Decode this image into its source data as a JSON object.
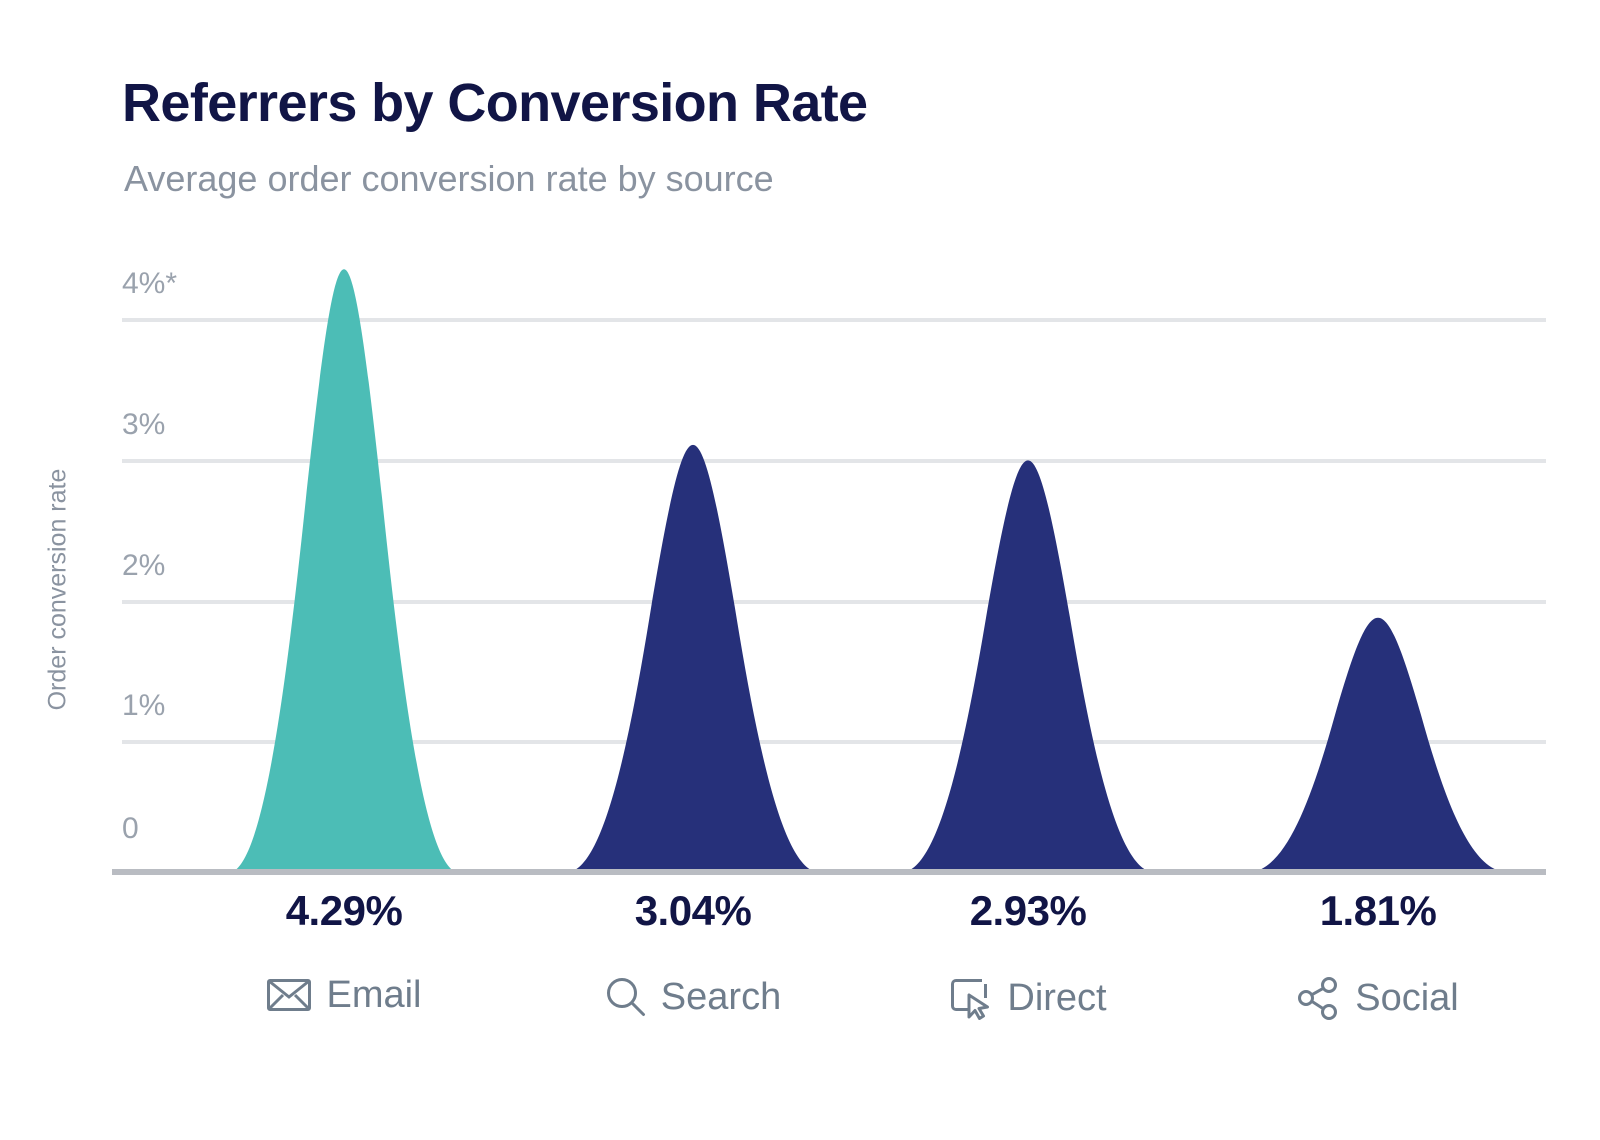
{
  "header": {
    "title": "Referrers by Conversion Rate",
    "subtitle": "Average order conversion rate by source"
  },
  "axis": {
    "y_title": "Order conversion rate",
    "y_ticks": [
      "4%*",
      "3%",
      "2%",
      "1%",
      "0"
    ]
  },
  "columns": [
    {
      "value_label": "4.29%",
      "name": "Email",
      "icon": "envelope-icon"
    },
    {
      "value_label": "3.04%",
      "name": "Search",
      "icon": "magnifier-icon"
    },
    {
      "value_label": "2.93%",
      "name": "Direct",
      "icon": "cursor-window-icon"
    },
    {
      "value_label": "1.81%",
      "name": "Social",
      "icon": "share-nodes-icon"
    }
  ],
  "colors": {
    "teal": "#4CBDB6",
    "navy": "#26307A",
    "title": "#111546",
    "muted": "#8a93a0",
    "label": "#6f7d8c",
    "gridline": "#e3e5e8",
    "baseline": "#b9bcc2"
  },
  "chart_data": {
    "type": "bar",
    "title": "Referrers by Conversion Rate",
    "subtitle": "Average order conversion rate by source",
    "categories": [
      "Email",
      "Search",
      "Direct",
      "Social"
    ],
    "values": [
      4.29,
      3.04,
      2.93,
      1.81
    ],
    "value_labels": [
      "4.29%",
      "3.04%",
      "2.93%",
      "1.81%"
    ],
    "series": [
      {
        "name": "Order conversion rate",
        "values": [
          4.29,
          3.04,
          2.93,
          1.81
        ],
        "colors": [
          "#4CBDB6",
          "#26307A",
          "#26307A",
          "#26307A"
        ]
      }
    ],
    "xlabel": "",
    "ylabel": "Order conversion rate",
    "ylim": [
      0,
      4.3
    ],
    "yticks": [
      0,
      1,
      2,
      3,
      4
    ],
    "ytick_labels": [
      "0",
      "1%",
      "2%",
      "3%",
      "4%*"
    ],
    "grid": true,
    "legend": false,
    "note": "4%* axis top tick carries an asterisk"
  }
}
